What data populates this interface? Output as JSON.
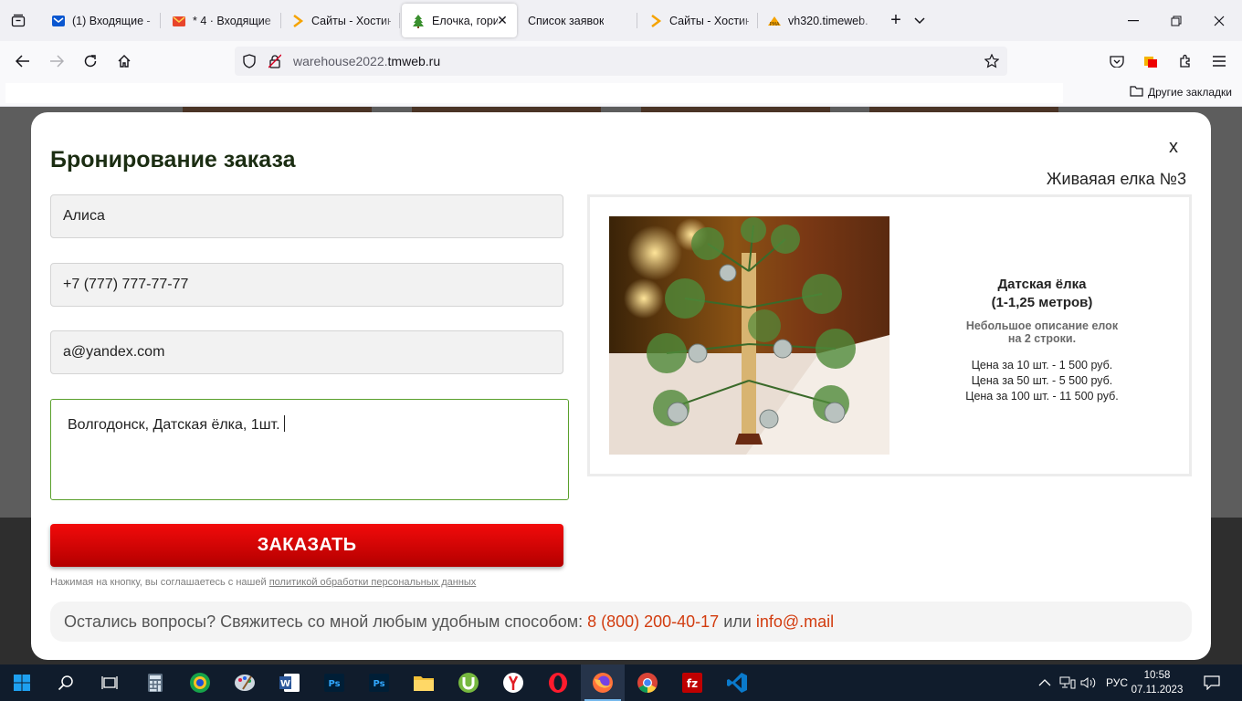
{
  "browser": {
    "tabs": [
      {
        "title": "(1) Входящие - ",
        "icon": "mail-icon",
        "color": "#0b57d0"
      },
      {
        "title": "* 4 · Входящие -",
        "icon": "yandex-mail-icon",
        "color": "#e8452c"
      },
      {
        "title": "Сайты - Хостин",
        "icon": "timeweb-arrow-icon",
        "color": "#f5a300"
      },
      {
        "title": "Елочка, гори",
        "icon": "tree-icon",
        "color": "#3a8f2e",
        "active": true
      },
      {
        "title": "Список заявок",
        "icon": "",
        "color": ""
      },
      {
        "title": "Сайты - Хостин",
        "icon": "timeweb-arrow-icon",
        "color": "#f5a300"
      },
      {
        "title": "vh320.timeweb.r",
        "icon": "pma-icon",
        "color": "#f5a300"
      }
    ],
    "url_dim": "warehouse2022.",
    "url_main": "tmweb.ru",
    "other_bookmarks": "Другие закладки"
  },
  "modal": {
    "title": "Бронирование заказа",
    "close": "x",
    "product_name": "Живаяая елка №3",
    "form": {
      "name_value": "Алиса",
      "phone_value": "+7 (777) 777-77-77",
      "email_value": "a@yandex.com",
      "comment_value": "Волгодонск, Датская ёлка, 1шт.",
      "submit_label": "ЗАКАЗАТЬ",
      "consent_text": "Нажимая на кнопку, вы соглашаетесь с нашей ",
      "consent_link": "политикой обработки персональных данных"
    },
    "product": {
      "title_line1": "Датская ёлка",
      "title_line2": "(1-1,25 метров)",
      "desc_line1": "Небольшое описание елок",
      "desc_line2": "на 2 строки.",
      "prices": [
        "Цена за 10 шт. - 1 500 руб.",
        "Цена за 50 шт. - 5 500 руб.",
        "Цена за 100 шт. - 11 500 руб."
      ]
    },
    "contact": {
      "text": "Остались вопросы? Свяжитесь со мной любым удобным способом: ",
      "phone": "8 (800) 200-40-17",
      "or": " или ",
      "email": "info@.mail"
    }
  },
  "taskbar": {
    "apps": [
      "start-icon",
      "search-icon",
      "task-view-icon",
      "calculator-icon",
      "browser-icon",
      "paint-icon",
      "word-icon",
      "photoshop-icon",
      "photoshop-icon",
      "folder-icon",
      "utorrent-icon",
      "yandex-browser-icon",
      "opera-icon",
      "firefox-icon",
      "chrome-icon",
      "filezilla-icon",
      "vscode-icon"
    ],
    "language": "РУС",
    "time": "10:58",
    "date": "07.11.2023"
  },
  "colors": {
    "accent_green": "#5aa02c",
    "button_red": "#e00000",
    "contact_accent": "#d23c0f",
    "title_dark_green": "#1b2d12"
  }
}
